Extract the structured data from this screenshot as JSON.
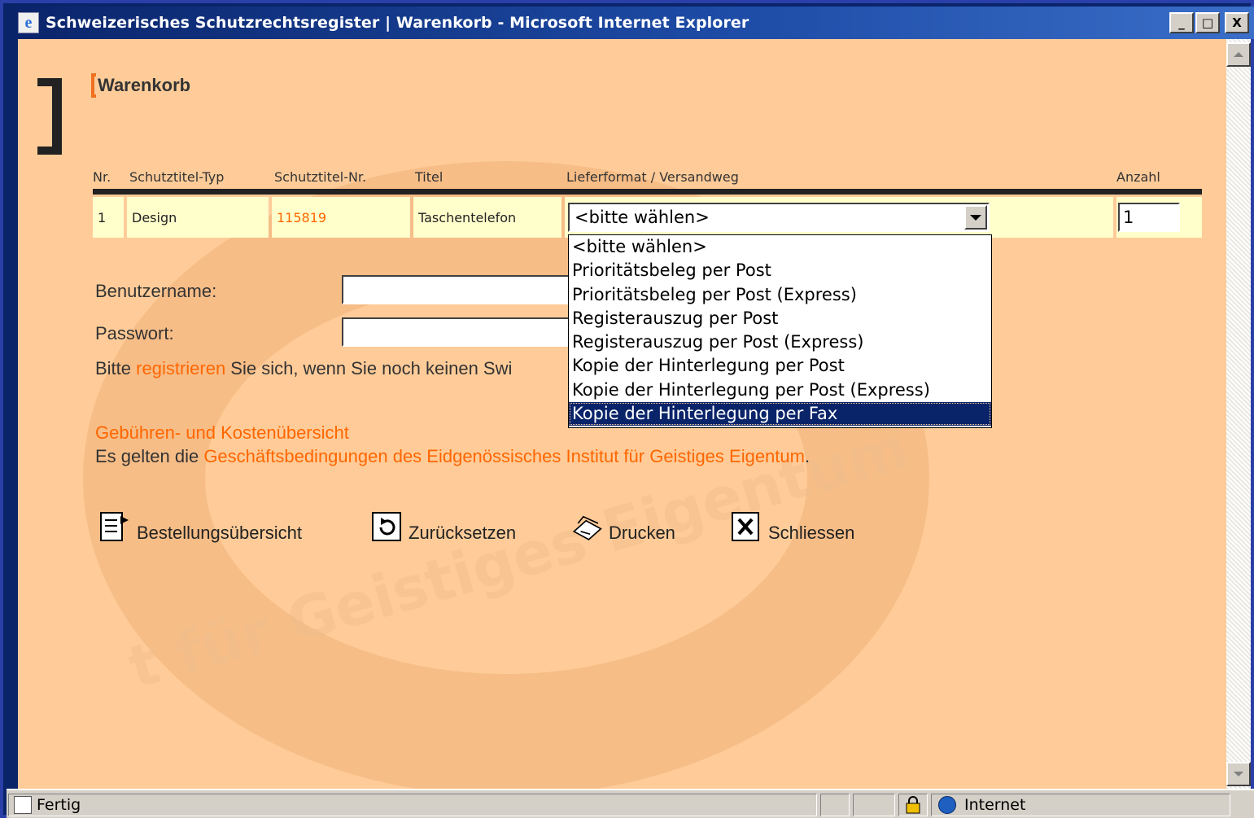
{
  "window": {
    "title": "Schweizerisches Schutzrechtsregister | Warenkorb - Microsoft Internet Explorer",
    "app_icon": "ie-icon",
    "controls": {
      "minimize": "_",
      "maximize": "□",
      "close": "X"
    }
  },
  "page": {
    "title": "Warenkorb",
    "table": {
      "headers": [
        "Nr.",
        "Schutztitel-Typ",
        "Schutztitel-Nr.",
        "Titel",
        "Lieferformat / Versandweg",
        "Anzahl"
      ],
      "rows": [
        {
          "nr": "1",
          "typ": "Design",
          "nummer": "115819",
          "titel": "Taschentelefon",
          "lieferformat": "<bitte wählen>",
          "anzahl": "1"
        }
      ]
    },
    "dropdown_options": [
      "<bitte wählen>",
      "Prioritätsbeleg per Post",
      "Prioritätsbeleg per Post (Express)",
      "Registerauszug per Post",
      "Registerauszug per Post (Express)",
      "Kopie der Hinterlegung per Post",
      "Kopie der Hinterlegung per Post (Express)",
      "Kopie der Hinterlegung per Fax"
    ],
    "dropdown_highlighted": "Kopie der Hinterlegung per Fax",
    "login": {
      "username_label": "Benutzername:",
      "password_label": "Passwort:",
      "username_value": "",
      "password_value": ""
    },
    "register_text": {
      "before": "Bitte ",
      "link": "registrieren",
      "after": " Sie sich, wenn Sie noch keinen Swi"
    },
    "fees_link": "Gebühren- und Kostenübersicht",
    "terms": {
      "before": "Es gelten die ",
      "link": "Geschäftsbedingungen des Eidgenössisches Institut für Geistiges Eigentum",
      "after": "."
    },
    "actions": {
      "overview": "Bestellungsübersicht",
      "reset": "Zurücksetzen",
      "print": "Drucken",
      "close": "Schliessen"
    },
    "watermark_text": "t für Geistiges Eigentum"
  },
  "statusbar": {
    "status": "Fertig",
    "zone": "Internet"
  },
  "colors": {
    "page_background": "#ffcc99",
    "row_background": "#ffffcc",
    "link": "#ff6600",
    "selection": "#0a246a"
  }
}
